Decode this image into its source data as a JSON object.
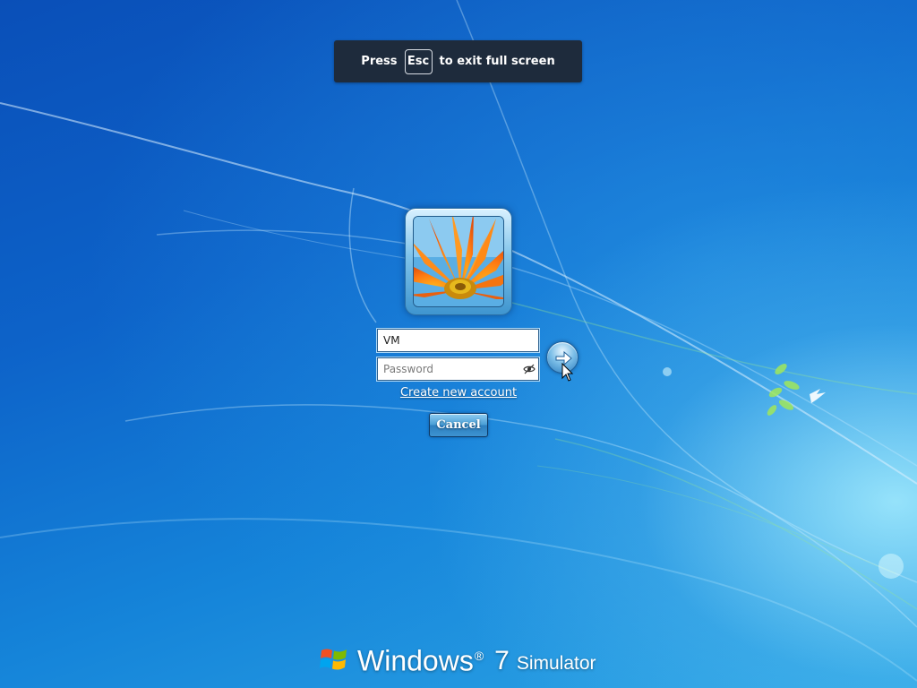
{
  "fullscreen_hint": {
    "prefix": "Press",
    "key": "Esc",
    "suffix": "to exit full screen"
  },
  "login": {
    "username_value": "VM",
    "password_value": "",
    "password_placeholder": "Password",
    "create_account_label": "Create new account",
    "cancel_label": "Cancel",
    "submit_icon": "arrow-right-icon",
    "reveal_icon": "eye-icon"
  },
  "branding": {
    "name": "Windows",
    "reg_mark": "®",
    "version": "7",
    "suffix": "Simulator",
    "logo_icon": "windows-logo-icon"
  },
  "colors": {
    "desktop_blue": "#0d63c9",
    "accent_light_blue": "#2ea7e6",
    "hint_background": "#1e2b3c"
  }
}
